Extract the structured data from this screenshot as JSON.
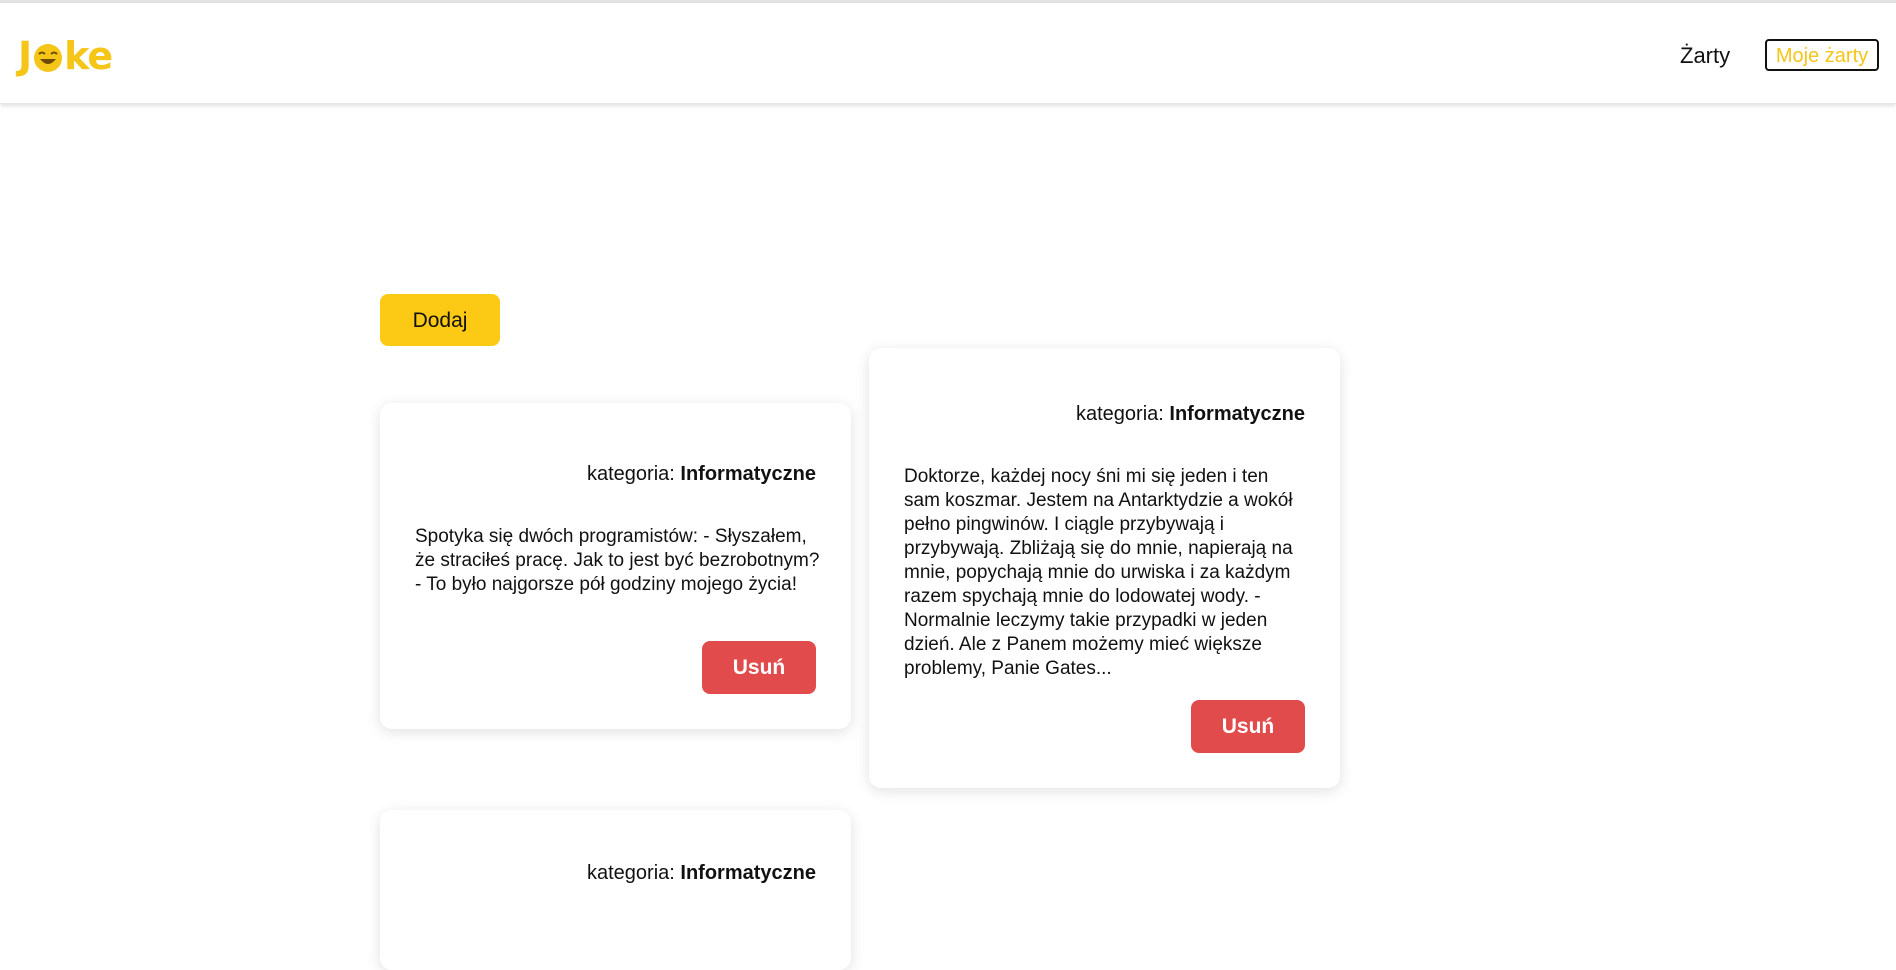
{
  "header": {
    "logo_text_left": "J",
    "logo_text_right": "ke",
    "nav": {
      "jokes_label": "Żarty",
      "my_jokes_label": "Moje żarty"
    },
    "colors": {
      "brand": "#f5c518"
    }
  },
  "main": {
    "add_label": "Dodaj",
    "category_prefix": "kategoria:",
    "delete_label": "Usuń",
    "cards": [
      {
        "category": "Informatyczne",
        "text": "Spotyka się dwóch programistów: - Słyszałem, że straciłeś pracę. Jak to jest być bezrobotnym? - To było najgorsze pół godziny mojego życia!"
      },
      {
        "category": "Informatyczne",
        "text": "Doktorze, każdej nocy śni mi się jeden i ten sam koszmar. Jestem na Antarktydzie a wokół pełno pingwinów. I ciągle przybywają i przybywają. Zbliżają się do mnie, napierają na mnie, popychają mnie do urwiska i za każdym razem spychają mnie do lodowatej wody. - Normalnie leczymy takie przypadki w jeden dzień. Ale z Panem możemy mieć większe problemy, Panie Gates..."
      },
      {
        "category": "Informatyczne",
        "text": ""
      }
    ],
    "colors": {
      "add_button": "#fcc914",
      "delete_button": "#e14b4b"
    }
  }
}
